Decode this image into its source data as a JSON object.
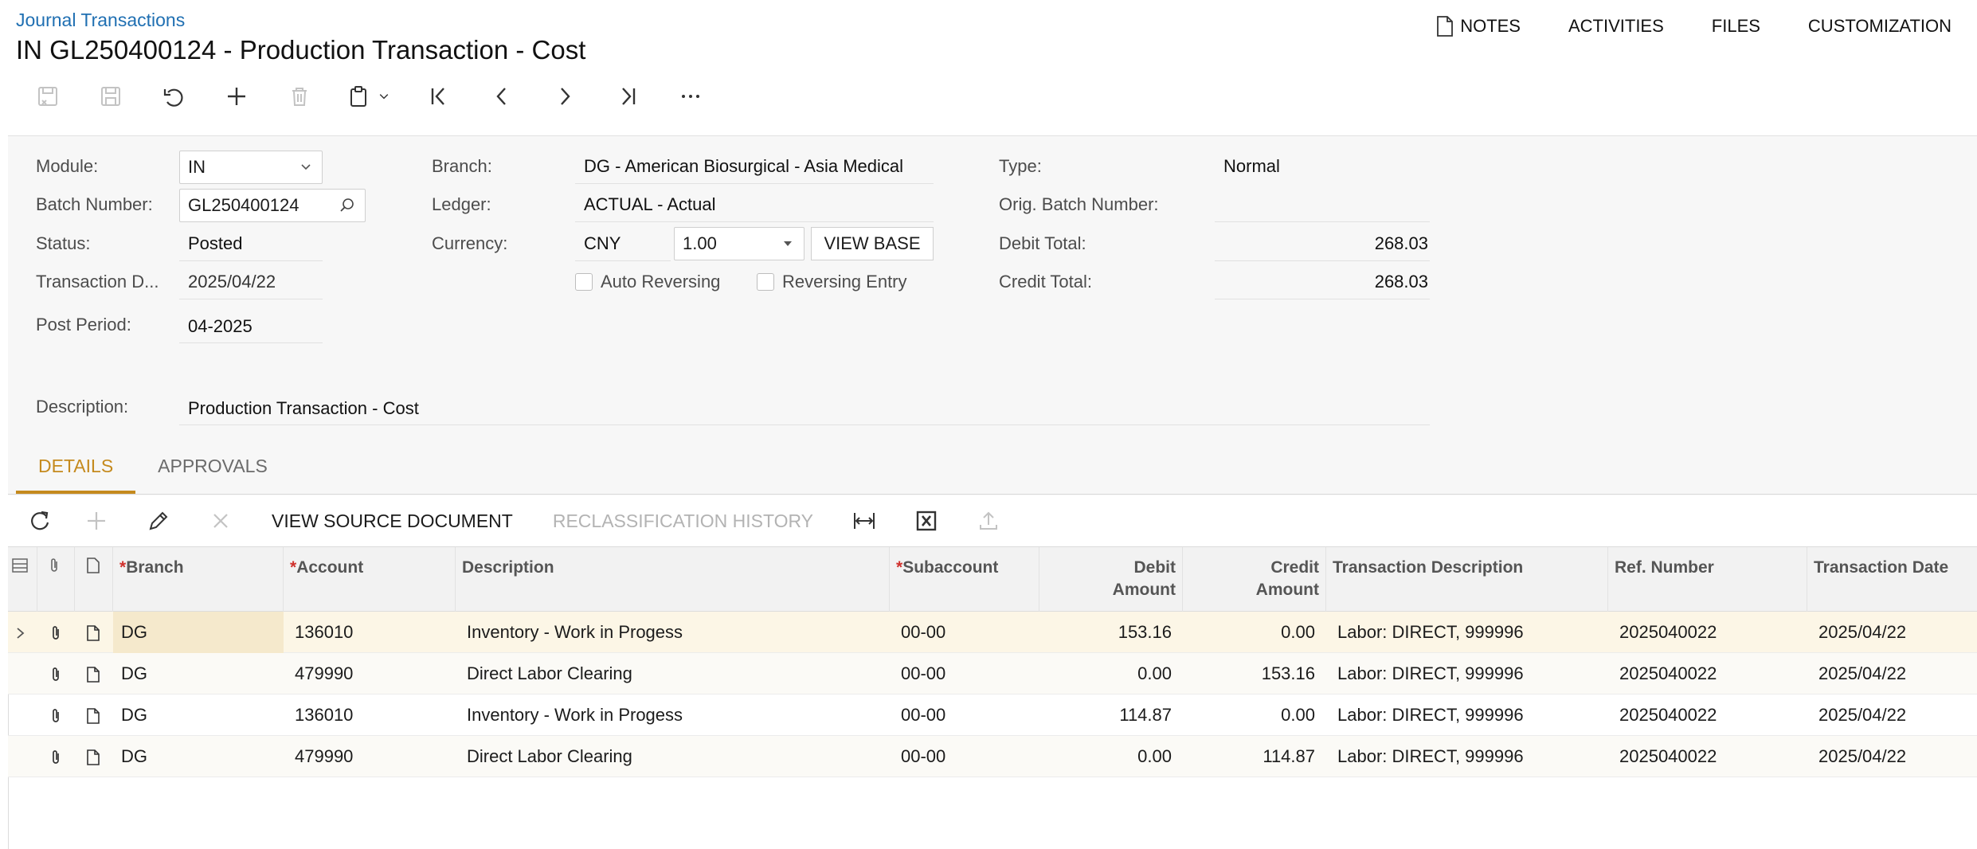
{
  "header": {
    "breadcrumb": "Journal Transactions",
    "title": "IN GL250400124 - Production Transaction - Cost",
    "links": [
      "NOTES",
      "ACTIVITIES",
      "FILES",
      "CUSTOMIZATION"
    ]
  },
  "toolbar": {
    "icons": [
      "save-close-icon",
      "save-icon",
      "undo-icon",
      "add-icon",
      "delete-icon",
      "clipboard-icon",
      "first-record-icon",
      "previous-record-icon",
      "next-record-icon",
      "last-record-icon",
      "more-icon"
    ]
  },
  "form": {
    "module": {
      "label": "Module:",
      "value": "IN"
    },
    "batch_number": {
      "label": "Batch Number:",
      "value": "GL250400124"
    },
    "status": {
      "label": "Status:",
      "value": "Posted"
    },
    "transaction_date": {
      "label": "Transaction D...",
      "value": "2025/04/22"
    },
    "post_period": {
      "label": "Post Period:",
      "value": "04-2025"
    },
    "branch": {
      "label": "Branch:",
      "value": "DG - American Biosurgical - Asia Medical"
    },
    "ledger": {
      "label": "Ledger:",
      "value": "ACTUAL - Actual"
    },
    "currency": {
      "label": "Currency:",
      "value": "CNY",
      "rate": "1.00",
      "view_base": "VIEW BASE"
    },
    "auto_reversing": {
      "label": "Auto Reversing",
      "checked": false
    },
    "reversing_entry": {
      "label": "Reversing Entry",
      "checked": false
    },
    "type": {
      "label": "Type:",
      "value": "Normal"
    },
    "orig_batch_number": {
      "label": "Orig. Batch Number:",
      "value": ""
    },
    "debit_total": {
      "label": "Debit Total:",
      "value": "268.03"
    },
    "credit_total": {
      "label": "Credit Total:",
      "value": "268.03"
    },
    "description": {
      "label": "Description:",
      "value": "Production Transaction - Cost"
    }
  },
  "tabs": [
    "DETAILS",
    "APPROVALS"
  ],
  "grid_toolbar": {
    "view_source": "VIEW SOURCE DOCUMENT",
    "reclass_history": "RECLASSIFICATION HISTORY"
  },
  "grid": {
    "columns": {
      "branch": "Branch",
      "account": "Account",
      "description": "Description",
      "subaccount": "Subaccount",
      "debit_line1": "Debit",
      "debit_line2": "Amount",
      "credit_line1": "Credit",
      "credit_line2": "Amount",
      "trans_desc": "Transaction Description",
      "ref_number": "Ref. Number",
      "trans_date": "Transaction Date"
    },
    "rows": [
      {
        "branch": "DG",
        "account": "136010",
        "description": "Inventory - Work in Progess",
        "subaccount": "00-00",
        "debit": "153.16",
        "credit": "0.00",
        "trans_desc": "Labor: DIRECT, 999996",
        "ref_number": "2025040022",
        "date": "2025/04/22"
      },
      {
        "branch": "DG",
        "account": "479990",
        "description": "Direct Labor Clearing",
        "subaccount": "00-00",
        "debit": "0.00",
        "credit": "153.16",
        "trans_desc": "Labor: DIRECT, 999996",
        "ref_number": "2025040022",
        "date": "2025/04/22"
      },
      {
        "branch": "DG",
        "account": "136010",
        "description": "Inventory - Work in Progess",
        "subaccount": "00-00",
        "debit": "114.87",
        "credit": "0.00",
        "trans_desc": "Labor: DIRECT, 999996",
        "ref_number": "2025040022",
        "date": "2025/04/22"
      },
      {
        "branch": "DG",
        "account": "479990",
        "description": "Direct Labor Clearing",
        "subaccount": "00-00",
        "debit": "0.00",
        "credit": "114.87",
        "trans_desc": "Labor: DIRECT, 999996",
        "ref_number": "2025040022",
        "date": "2025/04/22"
      }
    ]
  },
  "colors": {
    "link": "#1f6fb2",
    "accent": "#c58a1e",
    "required": "#d0312d",
    "selected_row": "#fcf6e6"
  }
}
